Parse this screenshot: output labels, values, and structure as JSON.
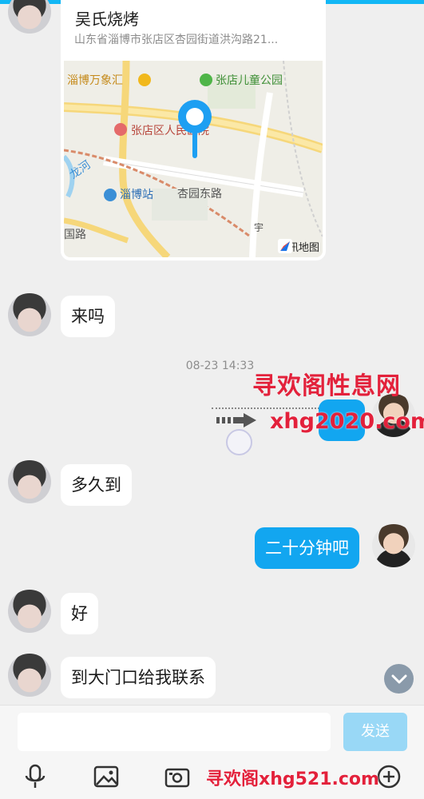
{
  "location": {
    "title": "吴氏烧烤",
    "address": "山东省淄博市张店区杏园街道洪沟路21...",
    "map_labels": {
      "mall": "淄博万象汇",
      "park": "张店儿童公园",
      "hospital": "张店区人民医院",
      "road": "杏园东路",
      "station": "淄博站",
      "river": "龙河",
      "road_left": "国路",
      "yu": "宇"
    },
    "attribution": "腾讯地图"
  },
  "messages": {
    "m1": "来吗",
    "timestamp": "08-23 14:33",
    "m2": "多久到",
    "m3": "二十分钟吧",
    "m4": "好",
    "m5": "到大门口给我联系"
  },
  "watermarks": {
    "top": "寻欢阁性息网",
    "mid": "xhg2020.com",
    "bottom": "寻欢阁xhg521.com"
  },
  "composer": {
    "input_value": "",
    "send_label": "发送"
  },
  "colors": {
    "accent": "#12a6f0",
    "send_disabled": "#99d8f6",
    "watermark": "#e3213b",
    "topbar": "#12b7f5"
  }
}
